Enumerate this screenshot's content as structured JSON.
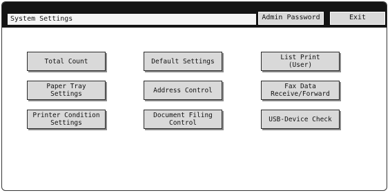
{
  "header": {
    "title": "System Settings",
    "admin_password_label": "Admin Password",
    "exit_label": "Exit"
  },
  "buttons": [
    {
      "id": "total-count",
      "label": "Total Count"
    },
    {
      "id": "default-settings",
      "label": "Default Settings"
    },
    {
      "id": "list-print-user",
      "label": "List Print\n(User)"
    },
    {
      "id": "paper-tray-settings",
      "label": "Paper Tray\nSettings"
    },
    {
      "id": "address-control",
      "label": "Address Control"
    },
    {
      "id": "fax-data-receive-forward",
      "label": "Fax Data\nReceive/Forward"
    },
    {
      "id": "printer-condition-settings",
      "label": "Printer Condition\nSettings"
    },
    {
      "id": "document-filing-control",
      "label": "Document Filing\nControl"
    },
    {
      "id": "usb-device-check",
      "label": "USB-Device Check"
    }
  ],
  "colors": {
    "titlebar": "#141414",
    "button_face": "#d9d9d9"
  }
}
